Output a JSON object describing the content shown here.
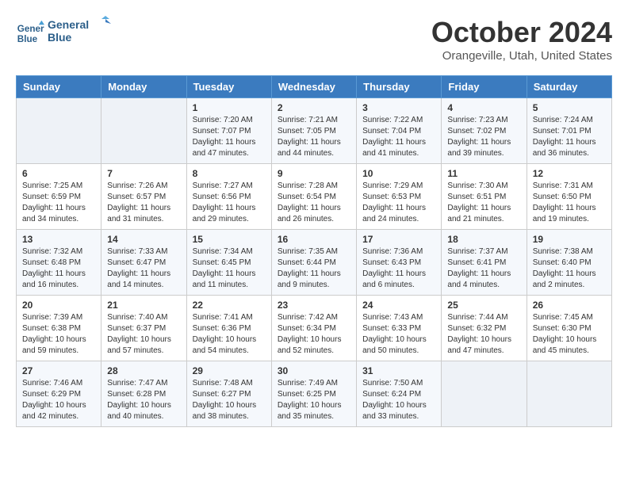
{
  "header": {
    "logo_line1": "General",
    "logo_line2": "Blue",
    "month_title": "October 2024",
    "location": "Orangeville, Utah, United States"
  },
  "days_of_week": [
    "Sunday",
    "Monday",
    "Tuesday",
    "Wednesday",
    "Thursday",
    "Friday",
    "Saturday"
  ],
  "weeks": [
    [
      {
        "day": "",
        "info": ""
      },
      {
        "day": "",
        "info": ""
      },
      {
        "day": "1",
        "info": "Sunrise: 7:20 AM\nSunset: 7:07 PM\nDaylight: 11 hours and 47 minutes."
      },
      {
        "day": "2",
        "info": "Sunrise: 7:21 AM\nSunset: 7:05 PM\nDaylight: 11 hours and 44 minutes."
      },
      {
        "day": "3",
        "info": "Sunrise: 7:22 AM\nSunset: 7:04 PM\nDaylight: 11 hours and 41 minutes."
      },
      {
        "day": "4",
        "info": "Sunrise: 7:23 AM\nSunset: 7:02 PM\nDaylight: 11 hours and 39 minutes."
      },
      {
        "day": "5",
        "info": "Sunrise: 7:24 AM\nSunset: 7:01 PM\nDaylight: 11 hours and 36 minutes."
      }
    ],
    [
      {
        "day": "6",
        "info": "Sunrise: 7:25 AM\nSunset: 6:59 PM\nDaylight: 11 hours and 34 minutes."
      },
      {
        "day": "7",
        "info": "Sunrise: 7:26 AM\nSunset: 6:57 PM\nDaylight: 11 hours and 31 minutes."
      },
      {
        "day": "8",
        "info": "Sunrise: 7:27 AM\nSunset: 6:56 PM\nDaylight: 11 hours and 29 minutes."
      },
      {
        "day": "9",
        "info": "Sunrise: 7:28 AM\nSunset: 6:54 PM\nDaylight: 11 hours and 26 minutes."
      },
      {
        "day": "10",
        "info": "Sunrise: 7:29 AM\nSunset: 6:53 PM\nDaylight: 11 hours and 24 minutes."
      },
      {
        "day": "11",
        "info": "Sunrise: 7:30 AM\nSunset: 6:51 PM\nDaylight: 11 hours and 21 minutes."
      },
      {
        "day": "12",
        "info": "Sunrise: 7:31 AM\nSunset: 6:50 PM\nDaylight: 11 hours and 19 minutes."
      }
    ],
    [
      {
        "day": "13",
        "info": "Sunrise: 7:32 AM\nSunset: 6:48 PM\nDaylight: 11 hours and 16 minutes."
      },
      {
        "day": "14",
        "info": "Sunrise: 7:33 AM\nSunset: 6:47 PM\nDaylight: 11 hours and 14 minutes."
      },
      {
        "day": "15",
        "info": "Sunrise: 7:34 AM\nSunset: 6:45 PM\nDaylight: 11 hours and 11 minutes."
      },
      {
        "day": "16",
        "info": "Sunrise: 7:35 AM\nSunset: 6:44 PM\nDaylight: 11 hours and 9 minutes."
      },
      {
        "day": "17",
        "info": "Sunrise: 7:36 AM\nSunset: 6:43 PM\nDaylight: 11 hours and 6 minutes."
      },
      {
        "day": "18",
        "info": "Sunrise: 7:37 AM\nSunset: 6:41 PM\nDaylight: 11 hours and 4 minutes."
      },
      {
        "day": "19",
        "info": "Sunrise: 7:38 AM\nSunset: 6:40 PM\nDaylight: 11 hours and 2 minutes."
      }
    ],
    [
      {
        "day": "20",
        "info": "Sunrise: 7:39 AM\nSunset: 6:38 PM\nDaylight: 10 hours and 59 minutes."
      },
      {
        "day": "21",
        "info": "Sunrise: 7:40 AM\nSunset: 6:37 PM\nDaylight: 10 hours and 57 minutes."
      },
      {
        "day": "22",
        "info": "Sunrise: 7:41 AM\nSunset: 6:36 PM\nDaylight: 10 hours and 54 minutes."
      },
      {
        "day": "23",
        "info": "Sunrise: 7:42 AM\nSunset: 6:34 PM\nDaylight: 10 hours and 52 minutes."
      },
      {
        "day": "24",
        "info": "Sunrise: 7:43 AM\nSunset: 6:33 PM\nDaylight: 10 hours and 50 minutes."
      },
      {
        "day": "25",
        "info": "Sunrise: 7:44 AM\nSunset: 6:32 PM\nDaylight: 10 hours and 47 minutes."
      },
      {
        "day": "26",
        "info": "Sunrise: 7:45 AM\nSunset: 6:30 PM\nDaylight: 10 hours and 45 minutes."
      }
    ],
    [
      {
        "day": "27",
        "info": "Sunrise: 7:46 AM\nSunset: 6:29 PM\nDaylight: 10 hours and 42 minutes."
      },
      {
        "day": "28",
        "info": "Sunrise: 7:47 AM\nSunset: 6:28 PM\nDaylight: 10 hours and 40 minutes."
      },
      {
        "day": "29",
        "info": "Sunrise: 7:48 AM\nSunset: 6:27 PM\nDaylight: 10 hours and 38 minutes."
      },
      {
        "day": "30",
        "info": "Sunrise: 7:49 AM\nSunset: 6:25 PM\nDaylight: 10 hours and 35 minutes."
      },
      {
        "day": "31",
        "info": "Sunrise: 7:50 AM\nSunset: 6:24 PM\nDaylight: 10 hours and 33 minutes."
      },
      {
        "day": "",
        "info": ""
      },
      {
        "day": "",
        "info": ""
      }
    ]
  ]
}
